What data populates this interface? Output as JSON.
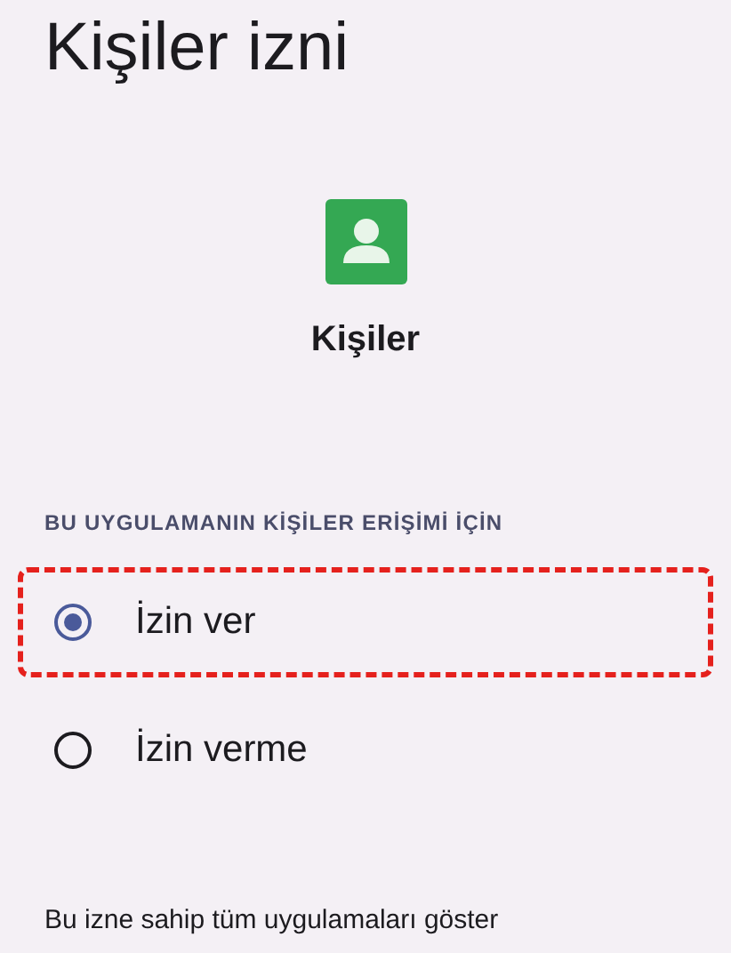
{
  "title": "Kişiler izni",
  "app": {
    "name": "Kişiler"
  },
  "section": {
    "heading": "BU UYGULAMANIN KİŞİLER ERİŞİMİ İÇİN"
  },
  "options": [
    {
      "label": "İzin ver",
      "selected": true,
      "highlighted": true
    },
    {
      "label": "İzin verme",
      "selected": false,
      "highlighted": false
    }
  ],
  "footer_link": "Bu izne sahip tüm uygulamaları göster"
}
